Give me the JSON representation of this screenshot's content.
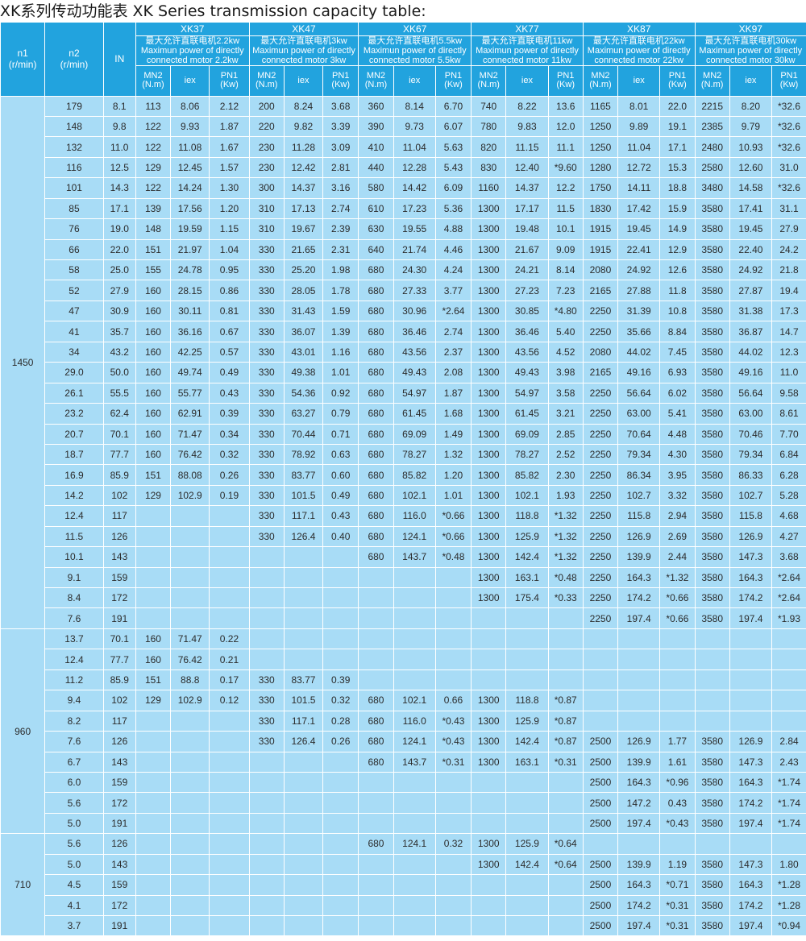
{
  "title": "XK系列传动功能表  XK Series transmission capacity table:",
  "header": {
    "n1_label": "n1",
    "n1_unit": "(r/min)",
    "n2_label": "n2",
    "n2_unit": "(r/min)",
    "in_label": "IN",
    "mn2_label": "MN2",
    "mn2_unit": "(N.m)",
    "iex_label": "iex",
    "pn1_label": "PN1",
    "pn1_unit": "(Kw)",
    "models": [
      {
        "name": "XK37",
        "cn": "最大允许直联电机2.2kw",
        "en1": "Maximun power of directly",
        "en2": "connected motor 2.2kw"
      },
      {
        "name": "XK47",
        "cn": "最大允许直联电机3kw",
        "en1": "Maximun power of directly",
        "en2": "connected motor 3kw"
      },
      {
        "name": "XK67",
        "cn": "最大允许直联电机5.5kw",
        "en1": "Maximun power of directly",
        "en2": "connected motor 5.5kw"
      },
      {
        "name": "XK77",
        "cn": "最大允许直联电机11kw",
        "en1": "Maximun power of directly",
        "en2": "connected motor 11kw"
      },
      {
        "name": "XK87",
        "cn": "最大允许直联电机22kw",
        "en1": "Maximun power of directly",
        "en2": "connected motor 22kw"
      },
      {
        "name": "XK97",
        "cn": "最大允许直联电机30kw",
        "en1": "Maximun power of directly",
        "en2": "connected motor 30kw"
      }
    ]
  },
  "groups": [
    {
      "n1": "1450",
      "rows": [
        [
          "179",
          "8.1",
          "113",
          "8.06",
          "2.12",
          "200",
          "8.24",
          "3.68",
          "360",
          "8.14",
          "6.70",
          "740",
          "8.22",
          "13.6",
          "1165",
          "8.01",
          "22.0",
          "2215",
          "8.20",
          "*32.6"
        ],
        [
          "148",
          "9.8",
          "122",
          "9.93",
          "1.87",
          "220",
          "9.82",
          "3.39",
          "390",
          "9.73",
          "6.07",
          "780",
          "9.83",
          "12.0",
          "1250",
          "9.89",
          "19.1",
          "2385",
          "9.79",
          "*32.6"
        ],
        [
          "132",
          "11.0",
          "122",
          "11.08",
          "1.67",
          "230",
          "11.28",
          "3.09",
          "410",
          "11.04",
          "5.63",
          "820",
          "11.15",
          "11.1",
          "1250",
          "11.04",
          "17.1",
          "2480",
          "10.93",
          "*32.6"
        ],
        [
          "116",
          "12.5",
          "129",
          "12.45",
          "1.57",
          "230",
          "12.42",
          "2.81",
          "440",
          "12.28",
          "5.43",
          "830",
          "12.40",
          "*9.60",
          "1280",
          "12.72",
          "15.3",
          "2580",
          "12.60",
          "31.0"
        ],
        [
          "101",
          "14.3",
          "122",
          "14.24",
          "1.30",
          "300",
          "14.37",
          "3.16",
          "580",
          "14.42",
          "6.09",
          "1160",
          "14.37",
          "12.2",
          "1750",
          "14.11",
          "18.8",
          "3480",
          "14.58",
          "*32.6"
        ],
        [
          "85",
          "17.1",
          "139",
          "17.56",
          "1.20",
          "310",
          "17.13",
          "2.74",
          "610",
          "17.23",
          "5.36",
          "1300",
          "17.17",
          "11.5",
          "1830",
          "17.42",
          "15.9",
          "3580",
          "17.41",
          "31.1"
        ],
        [
          "76",
          "19.0",
          "148",
          "19.59",
          "1.15",
          "310",
          "19.67",
          "2.39",
          "630",
          "19.55",
          "4.88",
          "1300",
          "19.48",
          "10.1",
          "1915",
          "19.45",
          "14.9",
          "3580",
          "19.45",
          "27.9"
        ],
        [
          "66",
          "22.0",
          "151",
          "21.97",
          "1.04",
          "330",
          "21.65",
          "2.31",
          "640",
          "21.74",
          "4.46",
          "1300",
          "21.67",
          "9.09",
          "1915",
          "22.41",
          "12.9",
          "3580",
          "22.40",
          "24.2"
        ],
        [
          "58",
          "25.0",
          "155",
          "24.78",
          "0.95",
          "330",
          "25.20",
          "1.98",
          "680",
          "24.30",
          "4.24",
          "1300",
          "24.21",
          "8.14",
          "2080",
          "24.92",
          "12.6",
          "3580",
          "24.92",
          "21.8"
        ],
        [
          "52",
          "27.9",
          "160",
          "28.15",
          "0.86",
          "330",
          "28.05",
          "1.78",
          "680",
          "27.33",
          "3.77",
          "1300",
          "27.23",
          "7.23",
          "2165",
          "27.88",
          "11.8",
          "3580",
          "27.87",
          "19.4"
        ],
        [
          "47",
          "30.9",
          "160",
          "30.11",
          "0.81",
          "330",
          "31.43",
          "1.59",
          "680",
          "30.96",
          "*2.64",
          "1300",
          "30.85",
          "*4.80",
          "2250",
          "31.39",
          "10.8",
          "3580",
          "31.38",
          "17.3"
        ],
        [
          "41",
          "35.7",
          "160",
          "36.16",
          "0.67",
          "330",
          "36.07",
          "1.39",
          "680",
          "36.46",
          "2.74",
          "1300",
          "36.46",
          "5.40",
          "2250",
          "35.66",
          "8.84",
          "3580",
          "36.87",
          "14.7"
        ],
        [
          "34",
          "43.2",
          "160",
          "42.25",
          "0.57",
          "330",
          "43.01",
          "1.16",
          "680",
          "43.56",
          "2.37",
          "1300",
          "43.56",
          "4.52",
          "2080",
          "44.02",
          "7.45",
          "3580",
          "44.02",
          "12.3"
        ],
        [
          "29.0",
          "50.0",
          "160",
          "49.74",
          "0.49",
          "330",
          "49.38",
          "1.01",
          "680",
          "49.43",
          "2.08",
          "1300",
          "49.43",
          "3.98",
          "2165",
          "49.16",
          "6.93",
          "3580",
          "49.16",
          "11.0"
        ],
        [
          "26.1",
          "55.5",
          "160",
          "55.77",
          "0.43",
          "330",
          "54.36",
          "0.92",
          "680",
          "54.97",
          "1.87",
          "1300",
          "54.97",
          "3.58",
          "2250",
          "56.64",
          "6.02",
          "3580",
          "56.64",
          "9.58"
        ],
        [
          "23.2",
          "62.4",
          "160",
          "62.91",
          "0.39",
          "330",
          "63.27",
          "0.79",
          "680",
          "61.45",
          "1.68",
          "1300",
          "61.45",
          "3.21",
          "2250",
          "63.00",
          "5.41",
          "3580",
          "63.00",
          "8.61"
        ],
        [
          "20.7",
          "70.1",
          "160",
          "71.47",
          "0.34",
          "330",
          "70.44",
          "0.71",
          "680",
          "69.09",
          "1.49",
          "1300",
          "69.09",
          "2.85",
          "2250",
          "70.64",
          "4.48",
          "3580",
          "70.46",
          "7.70"
        ],
        [
          "18.7",
          "77.7",
          "160",
          "76.42",
          "0.32",
          "330",
          "78.92",
          "0.63",
          "680",
          "78.27",
          "1.32",
          "1300",
          "78.27",
          "2.52",
          "2250",
          "79.34",
          "4.30",
          "3580",
          "79.34",
          "6.84"
        ],
        [
          "16.9",
          "85.9",
          "151",
          "88.08",
          "0.26",
          "330",
          "83.77",
          "0.60",
          "680",
          "85.82",
          "1.20",
          "1300",
          "85.82",
          "2.30",
          "2250",
          "86.34",
          "3.95",
          "3580",
          "86.33",
          "6.28"
        ],
        [
          "14.2",
          "102",
          "129",
          "102.9",
          "0.19",
          "330",
          "101.5",
          "0.49",
          "680",
          "102.1",
          "1.01",
          "1300",
          "102.1",
          "1.93",
          "2250",
          "102.7",
          "3.32",
          "3580",
          "102.7",
          "5.28"
        ],
        [
          "12.4",
          "117",
          "",
          "",
          "",
          "330",
          "117.1",
          "0.43",
          "680",
          "116.0",
          "*0.66",
          "1300",
          "118.8",
          "*1.32",
          "2250",
          "115.8",
          "2.94",
          "3580",
          "115.8",
          "4.68"
        ],
        [
          "11.5",
          "126",
          "",
          "",
          "",
          "330",
          "126.4",
          "0.40",
          "680",
          "124.1",
          "*0.66",
          "1300",
          "125.9",
          "*1.32",
          "2250",
          "126.9",
          "2.69",
          "3580",
          "126.9",
          "4.27"
        ],
        [
          "10.1",
          "143",
          "",
          "",
          "",
          "",
          "",
          "",
          "680",
          "143.7",
          "*0.48",
          "1300",
          "142.4",
          "*1.32",
          "2250",
          "139.9",
          "2.44",
          "3580",
          "147.3",
          "3.68"
        ],
        [
          "9.1",
          "159",
          "",
          "",
          "",
          "",
          "",
          "",
          "",
          "",
          "",
          "1300",
          "163.1",
          "*0.48",
          "2250",
          "164.3",
          "*1.32",
          "3580",
          "164.3",
          "*2.64"
        ],
        [
          "8.4",
          "172",
          "",
          "",
          "",
          "",
          "",
          "",
          "",
          "",
          "",
          "1300",
          "175.4",
          "*0.33",
          "2250",
          "174.2",
          "*0.66",
          "3580",
          "174.2",
          "*2.64"
        ],
        [
          "7.6",
          "191",
          "",
          "",
          "",
          "",
          "",
          "",
          "",
          "",
          "",
          "",
          "",
          "",
          "2250",
          "197.4",
          "*0.66",
          "3580",
          "197.4",
          "*1.93"
        ]
      ]
    },
    {
      "n1": "960",
      "rows": [
        [
          "13.7",
          "70.1",
          "160",
          "71.47",
          "0.22",
          "",
          "",
          "",
          "",
          "",
          "",
          "",
          "",
          "",
          "",
          "",
          "",
          "",
          "",
          ""
        ],
        [
          "12.4",
          "77.7",
          "160",
          "76.42",
          "0.21",
          "",
          "",
          "",
          "",
          "",
          "",
          "",
          "",
          "",
          "",
          "",
          "",
          "",
          "",
          ""
        ],
        [
          "11.2",
          "85.9",
          "151",
          "88.8",
          "0.17",
          "330",
          "83.77",
          "0.39",
          "",
          "",
          "",
          "",
          "",
          "",
          "",
          "",
          "",
          "",
          "",
          ""
        ],
        [
          "9.4",
          "102",
          "129",
          "102.9",
          "0.12",
          "330",
          "101.5",
          "0.32",
          "680",
          "102.1",
          "0.66",
          "1300",
          "118.8",
          "*0.87",
          "",
          "",
          "",
          "",
          "",
          ""
        ],
        [
          "8.2",
          "117",
          "",
          "",
          "",
          "330",
          "117.1",
          "0.28",
          "680",
          "116.0",
          "*0.43",
          "1300",
          "125.9",
          "*0.87",
          "",
          "",
          "",
          "",
          "",
          ""
        ],
        [
          "7.6",
          "126",
          "",
          "",
          "",
          "330",
          "126.4",
          "0.26",
          "680",
          "124.1",
          "*0.43",
          "1300",
          "142.4",
          "*0.87",
          "2500",
          "126.9",
          "1.77",
          "3580",
          "126.9",
          "2.84"
        ],
        [
          "6.7",
          "143",
          "",
          "",
          "",
          "",
          "",
          "",
          "680",
          "143.7",
          "*0.31",
          "1300",
          "163.1",
          "*0.31",
          "2500",
          "139.9",
          "1.61",
          "3580",
          "147.3",
          "2.43"
        ],
        [
          "6.0",
          "159",
          "",
          "",
          "",
          "",
          "",
          "",
          "",
          "",
          "",
          "",
          "",
          "",
          "2500",
          "164.3",
          "*0.96",
          "3580",
          "164.3",
          "*1.74"
        ],
        [
          "5.6",
          "172",
          "",
          "",
          "",
          "",
          "",
          "",
          "",
          "",
          "",
          "",
          "",
          "",
          "2500",
          "147.2",
          "0.43",
          "3580",
          "174.2",
          "*1.74"
        ],
        [
          "5.0",
          "191",
          "",
          "",
          "",
          "",
          "",
          "",
          "",
          "",
          "",
          "",
          "",
          "",
          "2500",
          "197.4",
          "*0.43",
          "3580",
          "197.4",
          "*1.74"
        ]
      ]
    },
    {
      "n1": "710",
      "rows": [
        [
          "5.6",
          "126",
          "",
          "",
          "",
          "",
          "",
          "",
          "680",
          "124.1",
          "0.32",
          "1300",
          "125.9",
          "*0.64",
          "",
          "",
          "",
          "",
          "",
          ""
        ],
        [
          "5.0",
          "143",
          "",
          "",
          "",
          "",
          "",
          "",
          "",
          "",
          "",
          "1300",
          "142.4",
          "*0.64",
          "2500",
          "139.9",
          "1.19",
          "3580",
          "147.3",
          "1.80"
        ],
        [
          "4.5",
          "159",
          "",
          "",
          "",
          "",
          "",
          "",
          "",
          "",
          "",
          "",
          "",
          "",
          "2500",
          "164.3",
          "*0.71",
          "3580",
          "164.3",
          "*1.28"
        ],
        [
          "4.1",
          "172",
          "",
          "",
          "",
          "",
          "",
          "",
          "",
          "",
          "",
          "",
          "",
          "",
          "2500",
          "174.2",
          "*0.31",
          "3580",
          "174.2",
          "*1.28"
        ],
        [
          "3.7",
          "191",
          "",
          "",
          "",
          "",
          "",
          "",
          "",
          "",
          "",
          "",
          "",
          "",
          "2500",
          "197.4",
          "*0.31",
          "3580",
          "197.4",
          "*0.94"
        ]
      ]
    }
  ]
}
